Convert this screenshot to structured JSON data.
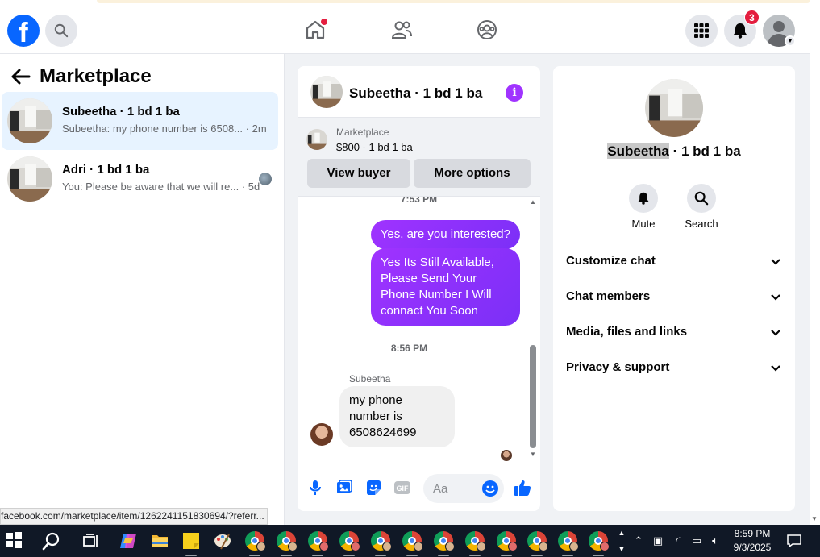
{
  "colors": {
    "facebook_blue": "#0866ff",
    "messenger_purple": "#a033ff",
    "badge_red": "#e41e3f",
    "active_row": "#e7f3ff"
  },
  "header": {
    "logo_letter": "f",
    "notifications_count": "3",
    "icons": [
      "facebook-logo-icon",
      "search-icon",
      "home-icon",
      "friends-icon",
      "groups-icon",
      "menu-grid-icon",
      "bell-icon",
      "profile-avatar-icon",
      "chevron-down-icon"
    ]
  },
  "left_panel": {
    "title": "Marketplace",
    "conversations": [
      {
        "name": "Subeetha · 1 bd 1 ba",
        "preview": "Subeetha: my phone number is 6508...",
        "time": "· 2m",
        "active": true
      },
      {
        "name": "Adri · 1 bd 1 ba",
        "preview": "You: Please be aware that we will re...",
        "time": "· 5d",
        "active": false
      }
    ],
    "status_url": "facebook.com/marketplace/item/1262241151830694/?referr..."
  },
  "chat": {
    "title": "Subeetha · 1 bd 1 ba",
    "listing": {
      "label": "Marketplace",
      "price_line": "$800 - 1 bd 1 ba",
      "view_buyer": "View buyer",
      "more_options": "More options"
    },
    "messages": {
      "time_top": "7:53 PM",
      "out_1": "Yes, are you interested?",
      "out_2": "Yes Its Still Available, Please Send Your Phone Number I Will connact You Soon",
      "time_mid": "8:56 PM",
      "sender": "Subeetha",
      "in_1": "my phone number is 6508624699"
    },
    "composer": {
      "placeholder": "Aa",
      "icons": [
        "microphone-icon",
        "photo-icon",
        "sticker-icon",
        "gif-icon",
        "emoji-icon",
        "thumbs-up-icon"
      ],
      "gif_label": "GIF"
    }
  },
  "right_panel": {
    "name_highlight": "Subeetha",
    "name_rest": " · 1 bd 1 ba",
    "actions": [
      {
        "label": "Mute",
        "icon": "bell-icon"
      },
      {
        "label": "Search",
        "icon": "search-icon"
      }
    ],
    "sections": [
      "Customize chat",
      "Chat members",
      "Media, files and links",
      "Privacy & support"
    ]
  },
  "taskbar": {
    "time": "8:59 PM",
    "date": "9/3/2025",
    "icons": [
      "windows-start-icon",
      "search-icon",
      "task-view-icon",
      "copilot-icon",
      "file-explorer-icon",
      "sticky-notes-icon",
      "paint-icon",
      "chrome-icon"
    ]
  }
}
